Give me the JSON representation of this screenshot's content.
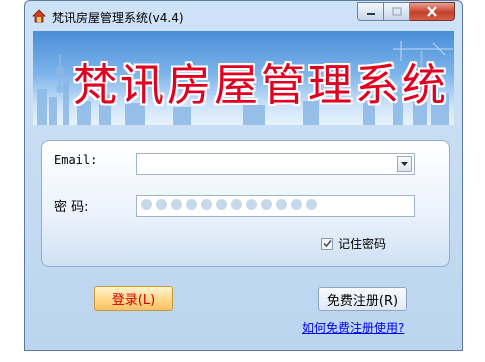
{
  "window": {
    "title": "梵讯房屋管理系统(v4.4)"
  },
  "banner": {
    "title": "梵讯房屋管理系统"
  },
  "form": {
    "email_label": "Email:",
    "email_value": "",
    "password_label": "密 码:",
    "password_mask_length": 12,
    "remember_label": "记住密码",
    "remember_checked": true
  },
  "actions": {
    "login_label": "登录(L)",
    "register_label": "免费注册(R)",
    "howto_link": "如何免费注册使用?"
  },
  "colors": {
    "banner_title": "#e00020",
    "login_text": "#d00000",
    "link": "#0000ee"
  }
}
